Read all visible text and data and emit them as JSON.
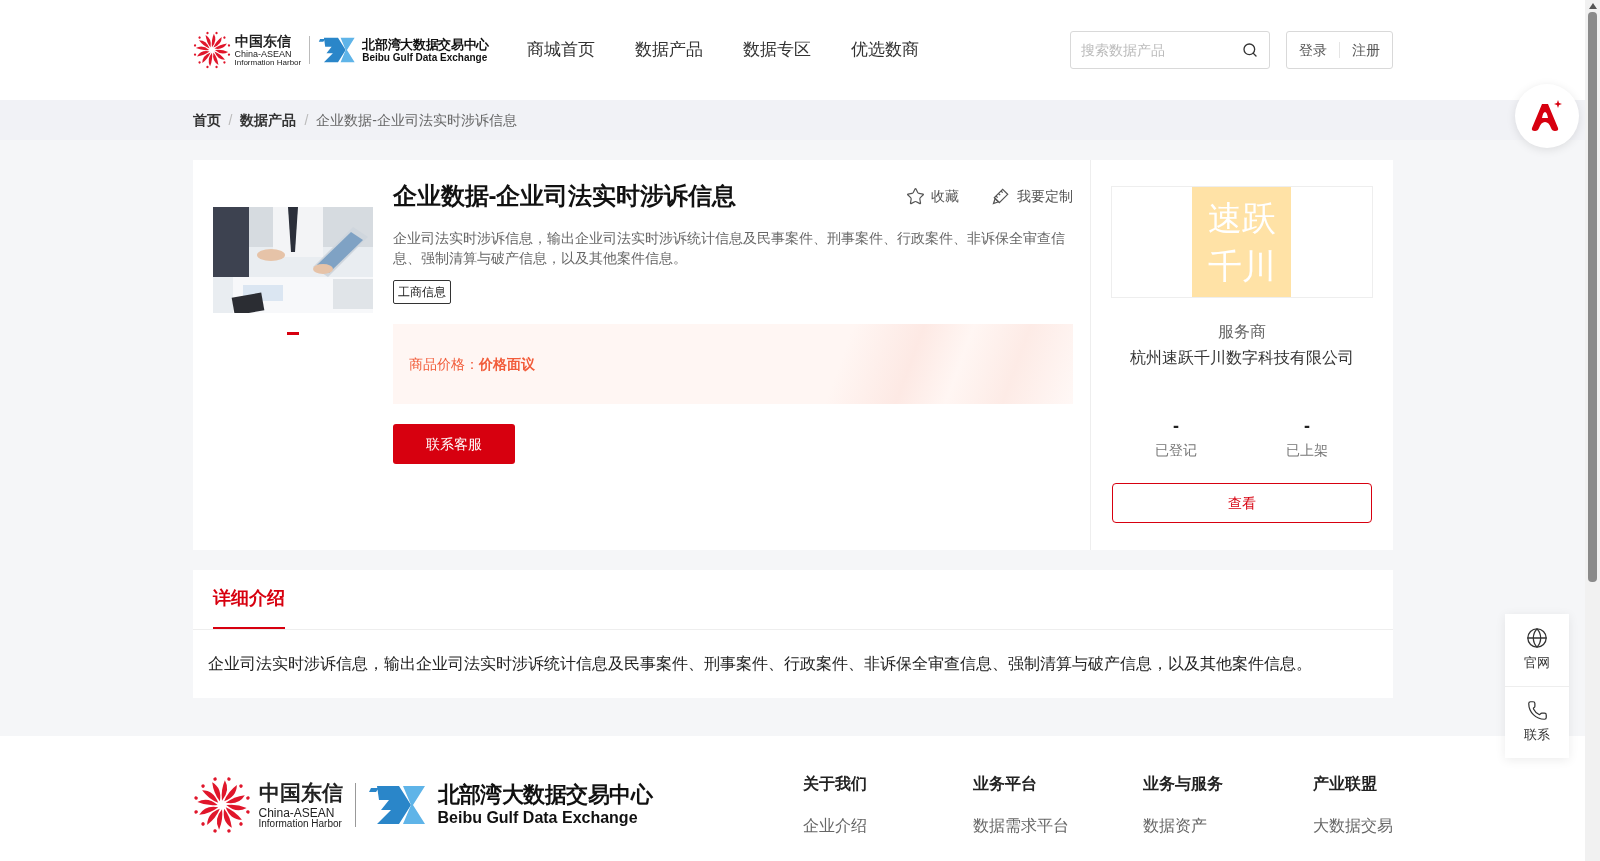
{
  "header": {
    "logo_a": {
      "cn": "中国东信",
      "en": "China-ASEAN",
      "sub": "Information Harbor"
    },
    "logo_b": {
      "cn": "北部湾大数据交易中心",
      "en": "Beibu Gulf Data Exchange"
    },
    "nav": [
      {
        "label": "商城首页",
        "selected": false
      },
      {
        "label": "数据产品",
        "selected": false
      },
      {
        "label": "数据专区",
        "selected": false
      },
      {
        "label": "优选数商",
        "selected": false
      }
    ],
    "search": {
      "placeholder": "搜索数据产品"
    },
    "auth": [
      "登录",
      "注册"
    ]
  },
  "breadcrumb": [
    {
      "label": "首页",
      "kind": "link"
    },
    {
      "separator": "/",
      "label": "数据产品",
      "kind": "link"
    },
    {
      "separator": "/",
      "label": "企业数据-企业司法实时涉诉信息",
      "kind": "current"
    }
  ],
  "product": {
    "title": "企业数据-企业司法实时涉诉信息",
    "actions": [
      {
        "label": "收藏",
        "kind": "star"
      },
      {
        "label": "我要定制",
        "kind": "custom"
      }
    ],
    "description": "企业司法实时涉诉信息，输出企业司法实时涉诉统计信息及民事案件、刑事案件、行政案件、非诉保全审查信息、强制清算与破产信息，以及其他案件信息。",
    "tags": [
      "工商信息"
    ],
    "image": {
      "kind": "picture"
    },
    "slides": [
      {
        "selected": true
      }
    ],
    "price_label": "商品价格：",
    "price_value": "价格面议",
    "contact_button": "联系客服"
  },
  "provider": {
    "logo_lines": [
      "速跃",
      "千川"
    ],
    "role": "服务商",
    "name": "杭州速跃千川数字科技有限公司",
    "stats": [
      {
        "value": "-",
        "label": "已登记"
      },
      {
        "value": "-",
        "label": "已上架"
      }
    ],
    "view_button": "查看"
  },
  "detail": {
    "tabs": [
      {
        "label": "详细介绍",
        "selected": true
      }
    ],
    "text": "企业司法实时涉诉信息，输出企业司法实时涉诉统计信息及民事案件、刑事案件、行政案件、非诉保全审查信息、强制清算与破产信息，以及其他案件信息。"
  },
  "float_panel": [
    {
      "label": "官网",
      "kind": "globe"
    },
    {
      "label": "联系",
      "kind": "phone"
    }
  ],
  "footer": {
    "logo_a": {
      "cn": "中国东信",
      "en": "China-ASEAN",
      "sub": "Information Harbor"
    },
    "logo_b": {
      "cn": "北部湾大数据交易中心",
      "en": "Beibu Gulf Data Exchange"
    },
    "columns": [
      {
        "title": "关于我们",
        "links": [
          "企业介绍"
        ]
      },
      {
        "title": "业务平台",
        "links": [
          "数据需求平台"
        ]
      },
      {
        "title": "业务与服务",
        "links": [
          "数据资产"
        ]
      },
      {
        "title": "产业联盟",
        "links": [
          "大数据交易"
        ]
      }
    ]
  }
}
